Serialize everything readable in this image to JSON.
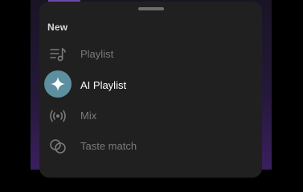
{
  "sheet": {
    "title": "New",
    "items": [
      {
        "label": "Playlist",
        "icon": "playlist-icon",
        "selected": false
      },
      {
        "label": "AI Playlist",
        "icon": "sparkle-icon",
        "selected": true
      },
      {
        "label": "Mix",
        "icon": "broadcast-icon",
        "selected": false
      },
      {
        "label": "Taste match",
        "icon": "overlapping-circles-icon",
        "selected": false
      }
    ]
  },
  "colors": {
    "sheet_bg": "#202020",
    "accent_circle": "#5c8f9f",
    "text_active": "#ffffff",
    "text_muted": "#7a7a7a"
  }
}
